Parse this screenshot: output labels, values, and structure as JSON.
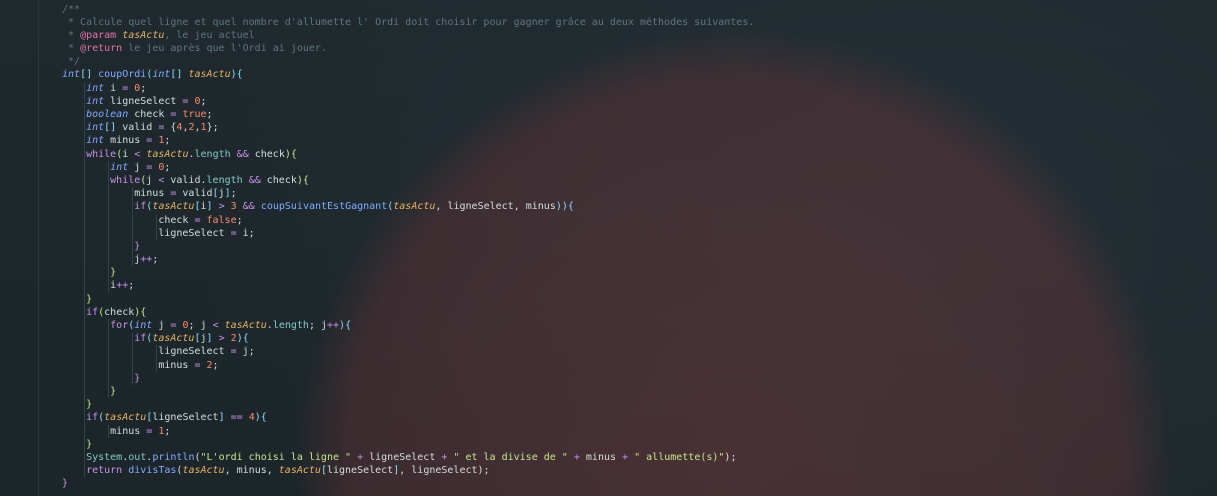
{
  "editor": {
    "language": "java",
    "lines": [
      [
        [
          "cm",
          "/**"
        ]
      ],
      [
        [
          "cm",
          " * Calcule quel ligne et quel nombre d'allumette l' Ordi doit choisir pour gagner grâce au deux méthodes suivantes."
        ]
      ],
      [
        [
          "cm",
          " * "
        ],
        [
          "tg",
          "@param"
        ],
        [
          "cm",
          " "
        ],
        [
          "pr",
          "tasActu"
        ],
        [
          "cm",
          ", le jeu actuel"
        ]
      ],
      [
        [
          "cm",
          " * "
        ],
        [
          "tg",
          "@return"
        ],
        [
          "cm",
          " le jeu après que l'Ordi ai jouer."
        ]
      ],
      [
        [
          "cm",
          " */"
        ]
      ],
      [
        [
          "ty",
          "int"
        ],
        [
          "bk",
          "[]"
        ],
        [
          "tx",
          " "
        ],
        [
          "fn",
          "coupOrdi"
        ],
        [
          "bk",
          "("
        ],
        [
          "ty",
          "int"
        ],
        [
          "bk",
          "[]"
        ],
        [
          "tx",
          " "
        ],
        [
          "pr",
          "tasActu"
        ],
        [
          "bk",
          "){"
        ]
      ],
      [
        [
          "ty",
          "int"
        ],
        [
          "tx",
          " i "
        ],
        [
          "op",
          "="
        ],
        [
          "tx",
          " "
        ],
        [
          "nm",
          "0"
        ],
        [
          "tx",
          ";"
        ]
      ],
      [
        [
          "ty",
          "int"
        ],
        [
          "tx",
          " ligneSelect "
        ],
        [
          "op",
          "="
        ],
        [
          "tx",
          " "
        ],
        [
          "nm",
          "0"
        ],
        [
          "tx",
          ";"
        ]
      ],
      [
        [
          "ty",
          "boolean"
        ],
        [
          "tx",
          " check "
        ],
        [
          "op",
          "="
        ],
        [
          "tx",
          " "
        ],
        [
          "nm",
          "true"
        ],
        [
          "tx",
          ";"
        ]
      ],
      [
        [
          "ty",
          "int"
        ],
        [
          "bk",
          "[]"
        ],
        [
          "tx",
          " valid "
        ],
        [
          "op",
          "="
        ],
        [
          "tx",
          " {"
        ],
        [
          "nm",
          "4"
        ],
        [
          "tx",
          ","
        ],
        [
          "nm",
          "2"
        ],
        [
          "tx",
          ","
        ],
        [
          "nm",
          "1"
        ],
        [
          "tx",
          "};"
        ]
      ],
      [
        [
          "ty",
          "int"
        ],
        [
          "tx",
          " minus "
        ],
        [
          "op",
          "="
        ],
        [
          "tx",
          " "
        ],
        [
          "nm",
          "1"
        ],
        [
          "tx",
          ";"
        ]
      ],
      [
        [
          "kw",
          "while"
        ],
        [
          "br2",
          "("
        ],
        [
          "tx",
          "i "
        ],
        [
          "op",
          "<"
        ],
        [
          "tx",
          " "
        ],
        [
          "pr",
          "tasActu"
        ],
        [
          "tx",
          "."
        ],
        [
          "fd",
          "length"
        ],
        [
          "tx",
          " "
        ],
        [
          "op",
          "&&"
        ],
        [
          "tx",
          " check"
        ],
        [
          "br2",
          "){"
        ]
      ],
      [
        [
          "ty",
          "int"
        ],
        [
          "tx",
          " j "
        ],
        [
          "op",
          "="
        ],
        [
          "tx",
          " "
        ],
        [
          "nm",
          "0"
        ],
        [
          "tx",
          ";"
        ]
      ],
      [
        [
          "kw",
          "while"
        ],
        [
          "br2",
          "("
        ],
        [
          "tx",
          "j "
        ],
        [
          "op",
          "<"
        ],
        [
          "tx",
          " valid."
        ],
        [
          "fd",
          "length"
        ],
        [
          "tx",
          " "
        ],
        [
          "op",
          "&&"
        ],
        [
          "tx",
          " check"
        ],
        [
          "br2",
          "){"
        ]
      ],
      [
        [
          "tx",
          "minus "
        ],
        [
          "op",
          "="
        ],
        [
          "tx",
          " valid"
        ],
        [
          "bk",
          "["
        ],
        [
          "tx",
          "j"
        ],
        [
          "bk",
          "]"
        ],
        [
          "tx",
          ";"
        ]
      ],
      [
        [
          "kw",
          "if"
        ],
        [
          "bk",
          "("
        ],
        [
          "pr",
          "tasActu"
        ],
        [
          "bk",
          "["
        ],
        [
          "tx",
          "i"
        ],
        [
          "bk",
          "]"
        ],
        [
          "tx",
          " "
        ],
        [
          "op",
          ">"
        ],
        [
          "tx",
          " "
        ],
        [
          "nm",
          "3"
        ],
        [
          "tx",
          " "
        ],
        [
          "op",
          "&&"
        ],
        [
          "tx",
          " "
        ],
        [
          "fn",
          "coupSuivantEstGagnant"
        ],
        [
          "bk",
          "("
        ],
        [
          "pr",
          "tasActu"
        ],
        [
          "tx",
          ", ligneSelect, minus"
        ],
        [
          "bk",
          "))"
        ],
        [
          "bk",
          "{"
        ]
      ],
      [
        [
          "tx",
          "check "
        ],
        [
          "op",
          "="
        ],
        [
          "tx",
          " "
        ],
        [
          "nm",
          "false"
        ],
        [
          "tx",
          ";"
        ]
      ],
      [
        [
          "tx",
          "ligneSelect "
        ],
        [
          "op",
          "="
        ],
        [
          "tx",
          " i;"
        ]
      ],
      [
        [
          "kw",
          "}"
        ]
      ],
      [
        [
          "tx",
          "j"
        ],
        [
          "op",
          "++"
        ],
        [
          "tx",
          ";"
        ]
      ],
      [
        [
          "br2",
          "}"
        ]
      ],
      [
        [
          "tx",
          "i"
        ],
        [
          "op",
          "++"
        ],
        [
          "tx",
          ";"
        ]
      ],
      [
        [
          "br2",
          "}"
        ]
      ],
      [
        [
          "kw",
          "if"
        ],
        [
          "br2",
          "("
        ],
        [
          "tx",
          "check"
        ],
        [
          "br2",
          "){"
        ]
      ],
      [
        [
          "kw",
          "for"
        ],
        [
          "bk",
          "("
        ],
        [
          "ty",
          "int"
        ],
        [
          "tx",
          " j "
        ],
        [
          "op",
          "="
        ],
        [
          "tx",
          " "
        ],
        [
          "nm",
          "0"
        ],
        [
          "tx",
          "; j "
        ],
        [
          "op",
          "<"
        ],
        [
          "tx",
          " "
        ],
        [
          "pr",
          "tasActu"
        ],
        [
          "tx",
          "."
        ],
        [
          "fd",
          "length"
        ],
        [
          "tx",
          "; j"
        ],
        [
          "op",
          "++"
        ],
        [
          "bk",
          "){"
        ]
      ],
      [
        [
          "kw",
          "if"
        ],
        [
          "bk",
          "("
        ],
        [
          "pr",
          "tasActu"
        ],
        [
          "bk",
          "["
        ],
        [
          "tx",
          "j"
        ],
        [
          "bk",
          "]"
        ],
        [
          "tx",
          " "
        ],
        [
          "op",
          ">"
        ],
        [
          "tx",
          " "
        ],
        [
          "nm",
          "2"
        ],
        [
          "bk",
          "){"
        ]
      ],
      [
        [
          "tx",
          "ligneSelect "
        ],
        [
          "op",
          "="
        ],
        [
          "tx",
          " j;"
        ]
      ],
      [
        [
          "tx",
          "minus "
        ],
        [
          "op",
          "="
        ],
        [
          "tx",
          " "
        ],
        [
          "nm",
          "2"
        ],
        [
          "tx",
          ";"
        ]
      ],
      [
        [
          "kw",
          "}"
        ]
      ],
      [
        [
          "br2",
          "}"
        ]
      ],
      [
        [
          "br2",
          "}"
        ]
      ],
      [
        [
          "kw",
          "if"
        ],
        [
          "bk",
          "("
        ],
        [
          "pr",
          "tasActu"
        ],
        [
          "bk",
          "["
        ],
        [
          "tx",
          "ligneSelect"
        ],
        [
          "bk",
          "]"
        ],
        [
          "tx",
          " "
        ],
        [
          "op",
          "=="
        ],
        [
          "tx",
          " "
        ],
        [
          "nm",
          "4"
        ],
        [
          "bk",
          "){"
        ]
      ],
      [
        [
          "tx",
          "minus "
        ],
        [
          "op",
          "="
        ],
        [
          "tx",
          " "
        ],
        [
          "nm",
          "1"
        ],
        [
          "tx",
          ";"
        ]
      ],
      [
        [
          "br2",
          "}"
        ]
      ],
      [
        [
          "fd",
          "System"
        ],
        [
          "tx",
          "."
        ],
        [
          "fd",
          "out"
        ],
        [
          "tx",
          "."
        ],
        [
          "fn",
          "println"
        ],
        [
          "tx",
          "("
        ],
        [
          "st",
          "\"L'ordi choisi la ligne \""
        ],
        [
          "tx",
          " "
        ],
        [
          "op",
          "+"
        ],
        [
          "tx",
          " ligneSelect "
        ],
        [
          "op",
          "+"
        ],
        [
          "tx",
          " "
        ],
        [
          "st",
          "\" et la divise de \""
        ],
        [
          "tx",
          " "
        ],
        [
          "op",
          "+"
        ],
        [
          "tx",
          " minus "
        ],
        [
          "op",
          "+"
        ],
        [
          "tx",
          " "
        ],
        [
          "st",
          "\" allumette(s)\""
        ],
        [
          "tx",
          ");"
        ]
      ],
      [
        [
          "kw",
          "return"
        ],
        [
          "tx",
          " "
        ],
        [
          "fn",
          "divisTas"
        ],
        [
          "tx",
          "("
        ],
        [
          "pr",
          "tasActu"
        ],
        [
          "tx",
          ", minus, "
        ],
        [
          "pr",
          "tasActu"
        ],
        [
          "bk",
          "["
        ],
        [
          "tx",
          "ligneSelect"
        ],
        [
          "bk",
          "]"
        ],
        [
          "tx",
          ", ligneSelect);"
        ]
      ],
      [
        [
          "op",
          "}"
        ]
      ]
    ],
    "indents": [
      0,
      0,
      0,
      0,
      0,
      0,
      1,
      1,
      1,
      1,
      1,
      1,
      2,
      2,
      3,
      3,
      4,
      4,
      3,
      3,
      2,
      2,
      1,
      1,
      2,
      3,
      4,
      4,
      3,
      2,
      1,
      1,
      2,
      1,
      1,
      1,
      0
    ]
  }
}
